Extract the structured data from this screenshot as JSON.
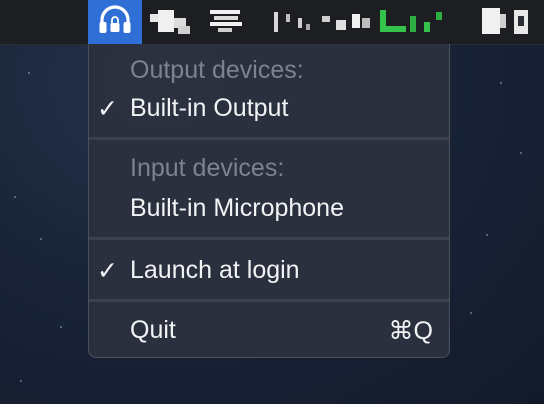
{
  "menubar": {
    "app_icon": "headphones-icon",
    "status_icons": [
      "status-icon-1",
      "status-icon-2",
      "status-icon-3",
      "status-icon-4",
      "status-icon-5",
      "status-icon-6"
    ]
  },
  "menu": {
    "output_header": "Output devices:",
    "output_items": [
      {
        "label": "Built-in Output",
        "checked": true
      }
    ],
    "input_header": "Input devices:",
    "input_items": [
      {
        "label": "Built-in Microphone",
        "checked": false
      }
    ],
    "launch_at_login": {
      "label": "Launch at login",
      "checked": true
    },
    "quit": {
      "label": "Quit",
      "shortcut": "⌘Q"
    },
    "check_glyph": "✓"
  },
  "colors": {
    "accent": "#2f6fd6",
    "menu_bg": "#2c313e",
    "header_text": "#7c8290",
    "item_text": "#f2f3f5"
  }
}
